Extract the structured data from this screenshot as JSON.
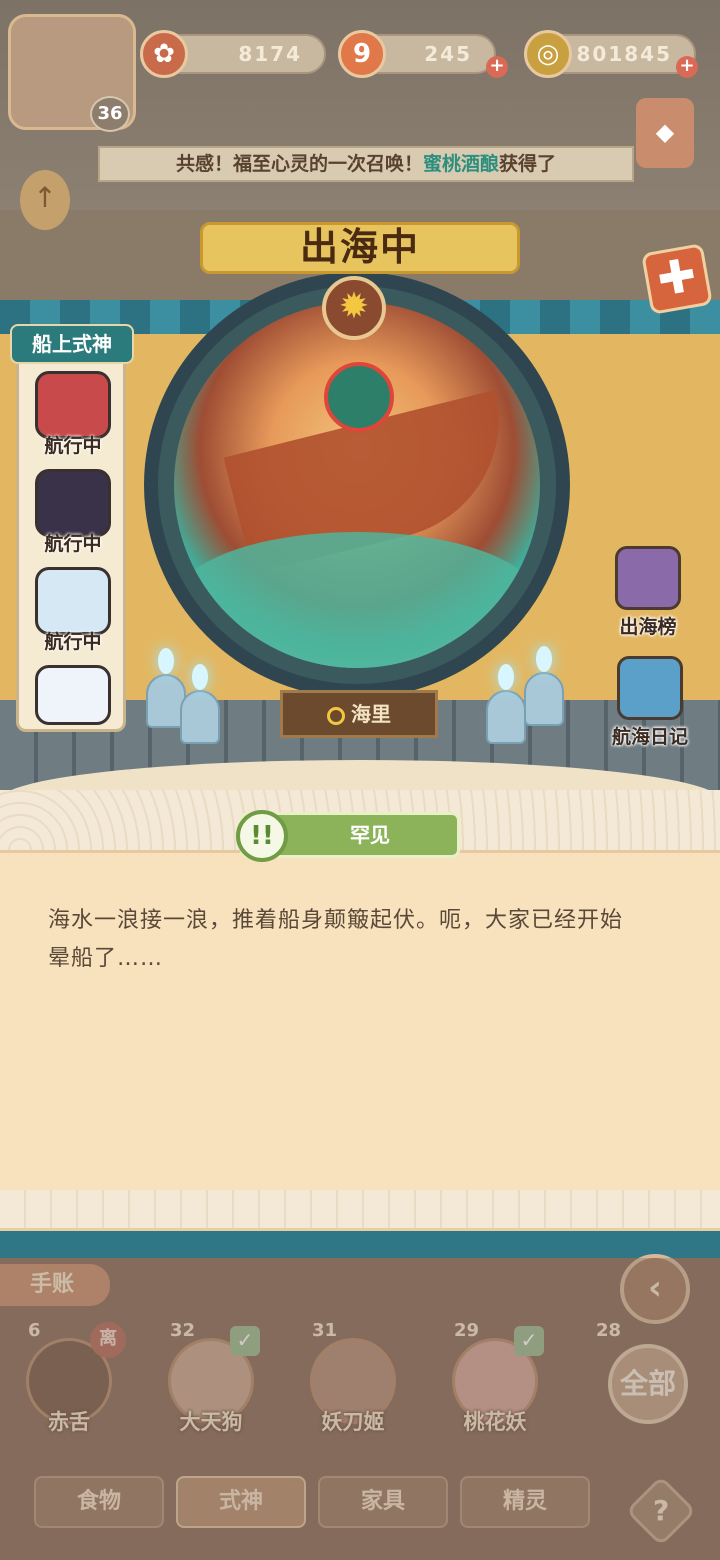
{
  "resources": {
    "stamina": "8174",
    "tickets": "245",
    "coins": "801845"
  },
  "player": {
    "level": "36"
  },
  "announcement": {
    "prefix": "共感！福至心灵的一次召唤！",
    "highlight": "蜜桃酒酿",
    "suffix": "获得了"
  },
  "voyage": {
    "title": "出海中",
    "distance_label": "海里",
    "distance_value": "0"
  },
  "crew": {
    "title": "船上式神",
    "members": [
      {
        "status": "航行中"
      },
      {
        "status": "航行中"
      },
      {
        "status": "航行中"
      },
      {
        "status": ""
      }
    ]
  },
  "side_buttons": {
    "ranking": "出海榜",
    "diary": "航海日记"
  },
  "event": {
    "rarity": "罕见",
    "badge_icon": "!!",
    "text_line1": "海水一浪接一浪，推着船身颠簸起伏。呃，大家已经开始",
    "text_line2": "晕船了……"
  },
  "bottom": {
    "notebook": "手账",
    "all_button": "全部",
    "away_badge": "离",
    "characters": [
      {
        "name": "赤舌",
        "level": "6"
      },
      {
        "name": "大天狗",
        "level": "32"
      },
      {
        "name": "妖刀姬",
        "level": "31"
      },
      {
        "name": "桃花妖",
        "level": "29"
      },
      {
        "name": "",
        "level": "28"
      }
    ],
    "tabs": [
      "食物",
      "式神",
      "家具",
      "精灵"
    ],
    "help": "?"
  },
  "colors": {
    "accent_teal": "#2f7686",
    "highlight_text": "#2f8f7f",
    "rarity_green": "#8cb35a"
  }
}
